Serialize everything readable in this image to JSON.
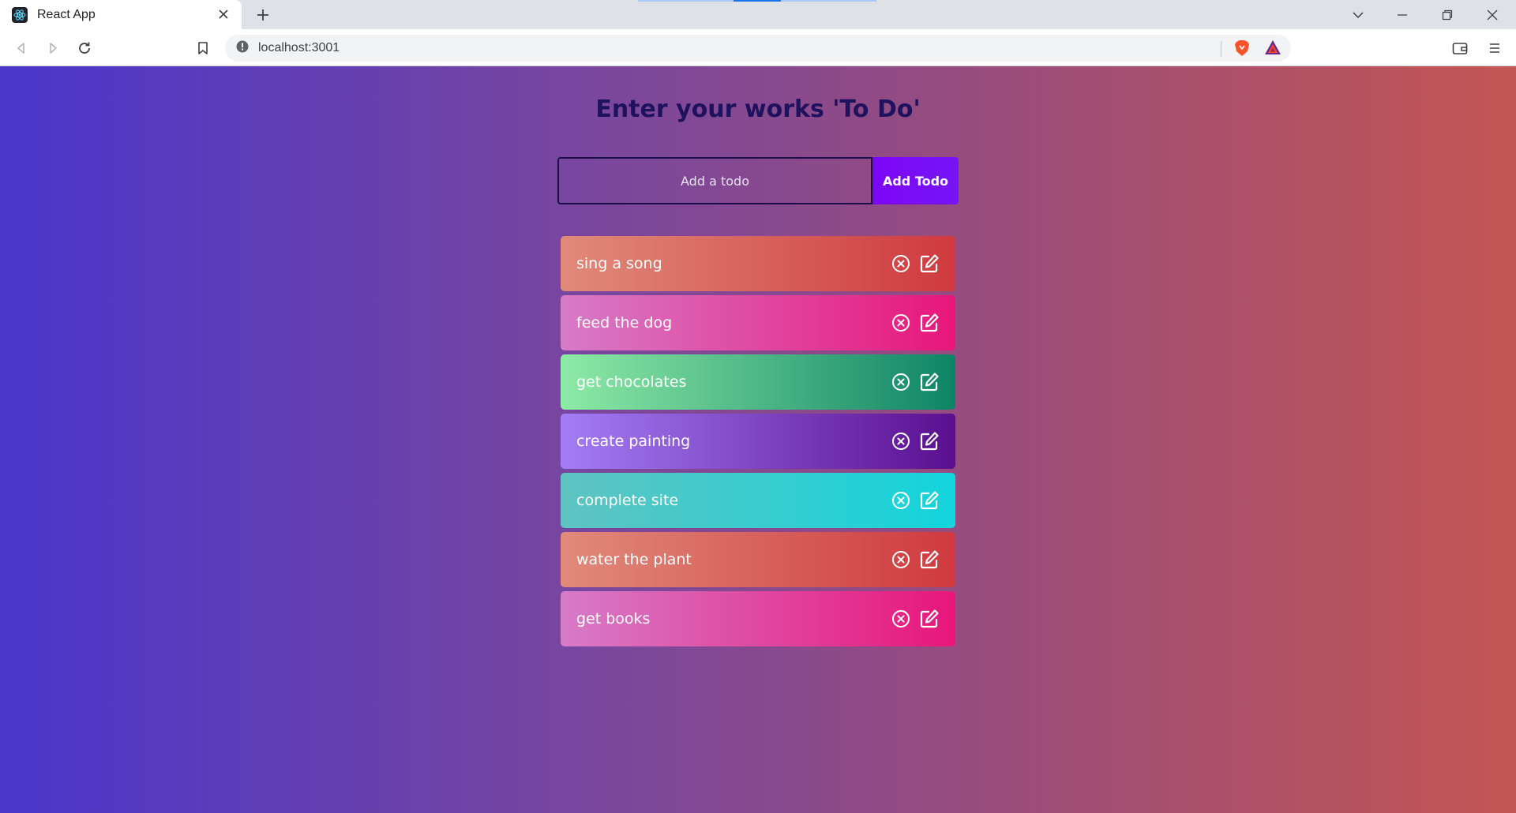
{
  "browser": {
    "tab_title": "React App",
    "url": "localhost:3001"
  },
  "app": {
    "heading": "Enter your works 'To Do'",
    "input": {
      "placeholder": "Add a todo",
      "value": ""
    },
    "add_button_label": "Add Todo",
    "todos": [
      {
        "text": "sing a song",
        "gradient": [
          "#e08a7a",
          "#cf3a3f"
        ]
      },
      {
        "text": "feed the dog",
        "gradient": [
          "#d77bc8",
          "#e8167a"
        ]
      },
      {
        "text": "get chocolates",
        "gradient": [
          "#8eeaa6",
          "#0e8466"
        ]
      },
      {
        "text": "create painting",
        "gradient": [
          "#a47df6",
          "#5a0f8f"
        ]
      },
      {
        "text": "complete site",
        "gradient": [
          "#5fc3c1",
          "#13d5dc"
        ]
      },
      {
        "text": "water the plant",
        "gradient": [
          "#e08a7a",
          "#cf3a3f"
        ]
      },
      {
        "text": "get books",
        "gradient": [
          "#d77bc8",
          "#e8167a"
        ]
      }
    ]
  },
  "colors": {
    "page_gradient": [
      "#4a36cb",
      "#c35653"
    ],
    "heading": "#1e115e",
    "button": "#7d06f5"
  }
}
